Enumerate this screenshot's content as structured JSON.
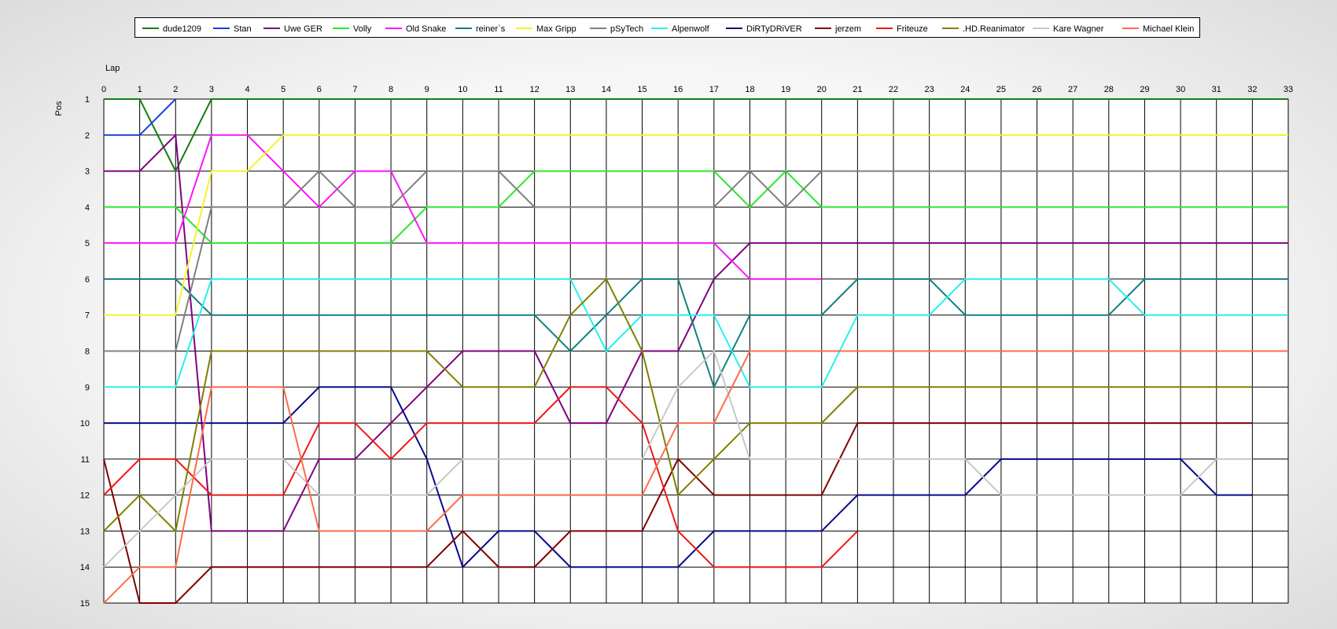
{
  "chart_data": {
    "type": "line",
    "xlabel": "Lap",
    "ylabel": "Pos",
    "xlim": [
      0,
      33
    ],
    "ylim": [
      1,
      15
    ],
    "y_inverted": true,
    "grid": true,
    "legend_position": "top",
    "x": [
      0,
      1,
      2,
      3,
      4,
      5,
      6,
      7,
      8,
      9,
      10,
      11,
      12,
      13,
      14,
      15,
      16,
      17,
      18,
      19,
      20,
      21,
      22,
      23,
      24,
      25,
      26,
      27,
      28,
      29,
      30,
      31,
      32,
      33
    ],
    "y_ticks": [
      1,
      2,
      3,
      4,
      5,
      6,
      7,
      8,
      9,
      10,
      11,
      12,
      13,
      14,
      15
    ],
    "series": [
      {
        "name": "dude1209",
        "color": "#137f13",
        "values": [
          1,
          1,
          3,
          1,
          1,
          1,
          1,
          1,
          1,
          1,
          1,
          1,
          1,
          1,
          1,
          1,
          1,
          1,
          1,
          1,
          1,
          1,
          1,
          1,
          1,
          1,
          1,
          1,
          1,
          1,
          1,
          1,
          1,
          1
        ]
      },
      {
        "name": "Stan",
        "color": "#1a3be0",
        "values": [
          2,
          2,
          1
        ]
      },
      {
        "name": "Uwe GER",
        "color": "#800080",
        "values": [
          3,
          3,
          2,
          13,
          13,
          13,
          11,
          11,
          10,
          9,
          8,
          8,
          8,
          10,
          10,
          8,
          8,
          6,
          5,
          5,
          5,
          5,
          5,
          5,
          5,
          5,
          5,
          5,
          5,
          5,
          5,
          5,
          5,
          5
        ]
      },
      {
        "name": "Volly",
        "color": "#2ee62e",
        "values": [
          4,
          4,
          4,
          5,
          5,
          5,
          5,
          5,
          5,
          4,
          4,
          4,
          3,
          3,
          3,
          3,
          3,
          3,
          4,
          3,
          4,
          4,
          4,
          4,
          4,
          4,
          4,
          4,
          4,
          4,
          4,
          4,
          4,
          4
        ]
      },
      {
        "name": "Old Snake",
        "color": "#ff14ff",
        "values": [
          5,
          5,
          5,
          2,
          2,
          3,
          4,
          3,
          3,
          5,
          5,
          5,
          5,
          5,
          5,
          5,
          5,
          5,
          6,
          6,
          6
        ]
      },
      {
        "name": "reiner`s",
        "color": "#128080",
        "values": [
          6,
          6,
          6,
          7,
          7,
          7,
          7,
          7,
          7,
          7,
          7,
          7,
          7,
          8,
          7,
          6,
          6,
          9,
          7,
          7,
          7,
          6,
          6,
          6,
          7,
          7,
          7,
          7,
          7,
          6,
          6,
          6,
          6,
          6
        ]
      },
      {
        "name": "Max Gripp",
        "color": "#f4f42a",
        "values": [
          7,
          7,
          7,
          3,
          3,
          2,
          2,
          2,
          2,
          2,
          2,
          2,
          2,
          2,
          2,
          2,
          2,
          2,
          2,
          2,
          2,
          2,
          2,
          2,
          2,
          2,
          2,
          2,
          2,
          2,
          2,
          2,
          2,
          2
        ]
      },
      {
        "name": "pSyTech",
        "color": "#808080",
        "values": [
          8,
          8,
          8,
          4,
          4,
          4,
          3,
          4,
          4,
          3,
          3,
          3,
          4,
          4,
          4,
          4,
          4,
          4,
          3,
          4,
          3,
          3,
          3,
          3,
          3,
          3,
          3,
          3,
          3,
          3,
          3,
          3,
          3,
          3
        ]
      },
      {
        "name": "Alpenwolf",
        "color": "#25f0f0",
        "values": [
          9,
          9,
          9,
          6,
          6,
          6,
          6,
          6,
          6,
          6,
          6,
          6,
          6,
          6,
          8,
          7,
          7,
          7,
          9,
          9,
          9,
          7,
          7,
          7,
          6,
          6,
          6,
          6,
          6,
          7,
          7,
          7,
          7,
          7
        ]
      },
      {
        "name": "DiRTyDRiVER",
        "color": "#0a0a8c",
        "values": [
          10,
          10,
          10,
          10,
          10,
          10,
          9,
          9,
          9,
          11,
          14,
          13,
          13,
          14,
          14,
          14,
          14,
          13,
          13,
          13,
          13,
          12,
          12,
          12,
          12,
          11,
          11,
          11,
          11,
          11,
          11,
          12,
          12
        ]
      },
      {
        "name": "jerzem",
        "color": "#800000",
        "values": [
          11,
          15,
          15,
          14,
          14,
          14,
          14,
          14,
          14,
          14,
          13,
          14,
          14,
          13,
          13,
          13,
          11,
          12,
          12,
          12,
          12,
          10,
          10,
          10,
          10,
          10,
          10,
          10,
          10,
          10,
          10,
          10,
          10
        ]
      },
      {
        "name": "Friteuze",
        "color": "#f01818",
        "values": [
          12,
          11,
          11,
          12,
          12,
          12,
          10,
          10,
          11,
          10,
          10,
          10,
          10,
          9,
          9,
          10,
          13,
          14,
          14,
          14,
          14,
          13
        ]
      },
      {
        "name": ".HD.Reanimator",
        "color": "#808000",
        "values": [
          13,
          12,
          13,
          8,
          8,
          8,
          8,
          8,
          8,
          8,
          9,
          9,
          9,
          7,
          6,
          8,
          12,
          11,
          10,
          10,
          10,
          9,
          9,
          9,
          9,
          9,
          9,
          9,
          9,
          9,
          9,
          9,
          9
        ]
      },
      {
        "name": "Kare Wagner",
        "color": "#c8c8c8",
        "values": [
          14,
          13,
          12,
          11,
          11,
          11,
          12,
          12,
          12,
          12,
          11,
          11,
          11,
          11,
          11,
          11,
          9,
          8,
          11,
          11,
          11,
          11,
          11,
          11,
          11,
          12,
          12,
          12,
          12,
          12,
          12,
          11,
          11
        ]
      },
      {
        "name": "Michael Klein",
        "color": "#ff6a4a",
        "values": [
          15,
          14,
          14,
          9,
          9,
          9,
          13,
          13,
          13,
          13,
          12,
          12,
          12,
          12,
          12,
          12,
          10,
          10,
          8,
          8,
          8,
          8,
          8,
          8,
          8,
          8,
          8,
          8,
          8,
          8,
          8,
          8,
          8,
          8
        ]
      }
    ]
  }
}
